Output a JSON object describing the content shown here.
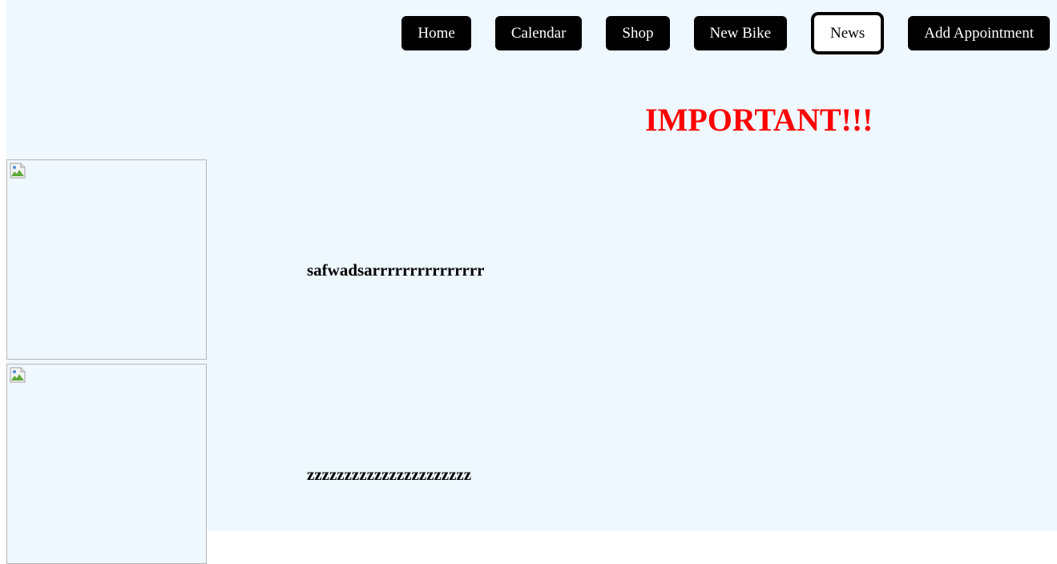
{
  "nav": {
    "items": [
      {
        "label": "Home",
        "active": false
      },
      {
        "label": "Calendar",
        "active": false
      },
      {
        "label": "Shop",
        "active": false
      },
      {
        "label": "New Bike",
        "active": false
      },
      {
        "label": "News",
        "active": true
      },
      {
        "label": "Add Appointment",
        "active": false
      }
    ]
  },
  "main": {
    "headline": "IMPORTANT!!!",
    "news_items": [
      {
        "text": "safwadsarrrrrrrrrrrrrrr",
        "image_icon": "broken-image-icon"
      },
      {
        "text": "zzzzzzzzzzzzzzzzzzzzzz",
        "image_icon": "broken-image-icon"
      }
    ]
  },
  "colors": {
    "background": "#eff7ff",
    "headline": "#ff0000",
    "nav_button_bg": "#000000",
    "nav_button_text": "#ffffff",
    "nav_active_bg": "#ffffff"
  }
}
